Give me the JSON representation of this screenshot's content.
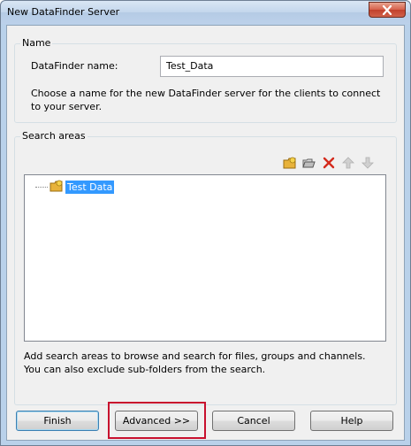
{
  "window": {
    "title": "New DataFinder Server"
  },
  "name_group": {
    "label": "Name",
    "field_label": "DataFinder name:",
    "field_value": "Test_Data",
    "description": "Choose a name for the new DataFinder server for the clients to connect to your server."
  },
  "search_group": {
    "label": "Search areas",
    "toolbar": [
      "add-area-icon",
      "add-folder-icon",
      "delete-icon",
      "move-up-icon",
      "move-down-icon"
    ],
    "tree_items": [
      {
        "label": "Test Data",
        "selected": true
      }
    ],
    "description": "Add search areas to browse and search for files, groups and channels. You can also exclude sub-folders from the search."
  },
  "buttons": {
    "finish": "Finish",
    "advanced": "Advanced >>",
    "cancel": "Cancel",
    "help": "Help"
  },
  "colors": {
    "highlight_box": "#c8102e",
    "selection": "#3399ff"
  }
}
